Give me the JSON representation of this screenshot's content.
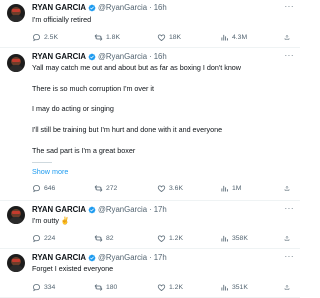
{
  "author": {
    "name": "RYAN GARCIA",
    "handle": "@RyanGarcia",
    "separator": "·",
    "more_glyph": "···"
  },
  "tweets": [
    {
      "time": "16h",
      "lines": [
        "I'm officially retired"
      ],
      "replies": "2.5K",
      "retweets": "1.8K",
      "likes": "18K",
      "views": "4.3M"
    },
    {
      "time": "16h",
      "lines": [
        "Yall may catch me out and about but as far as boxing I don't know",
        "There is so much corruption I'm over it",
        "I may do acting or singing",
        "I'll still be training but I'm hurt and done with it and everyone",
        "The sad part is I'm a great boxer"
      ],
      "show_more": "Show more",
      "replies": "646",
      "retweets": "272",
      "likes": "3.6K",
      "views": "1M"
    },
    {
      "time": "17h",
      "lines": [
        "I'm outty ✌️"
      ],
      "replies": "224",
      "retweets": "82",
      "likes": "1.2K",
      "views": "358K"
    },
    {
      "time": "17h",
      "lines": [
        "Forget I existed everyone"
      ],
      "replies": "334",
      "retweets": "180",
      "likes": "1.2K",
      "views": "351K"
    }
  ],
  "colors": {
    "verified": "#1d9bf0",
    "muted": "#536471",
    "link": "#1d9bf0"
  },
  "icons": [
    "verified-badge-icon",
    "reply-icon",
    "retweet-icon",
    "like-icon",
    "views-icon",
    "share-icon",
    "more-icon"
  ]
}
